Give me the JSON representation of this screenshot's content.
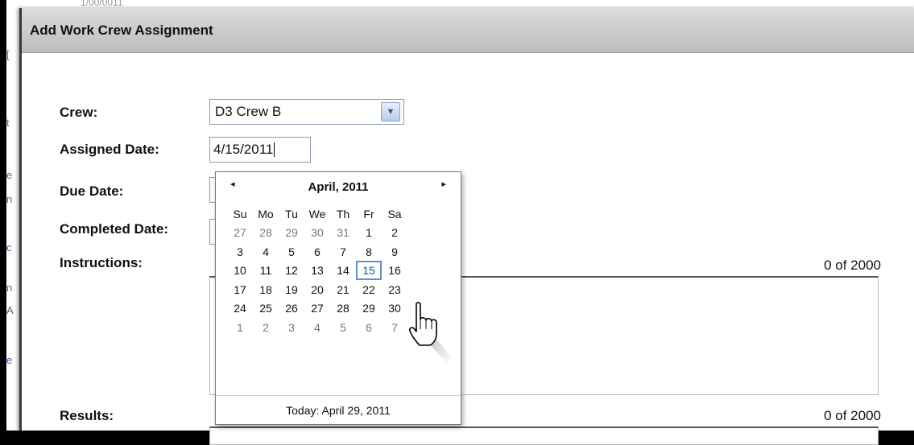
{
  "background": {
    "top_text": "1/00/0011",
    "sliver_chars": [
      "[",
      "t",
      "e",
      "n",
      "c",
      "n",
      "A",
      "e"
    ]
  },
  "dialog": {
    "title": "Add Work Crew Assignment",
    "fields": {
      "crew_label": "Crew:",
      "crew_value": "D3 Crew B",
      "assigned_date_label": "Assigned Date:",
      "assigned_date_value": "4/15/2011",
      "due_date_label": "Due Date:",
      "completed_date_label": "Completed Date:",
      "instructions_label": "Instructions:",
      "instructions_counter": "0 of 2000",
      "results_label": "Results:",
      "results_counter": "0 of 2000"
    }
  },
  "calendar": {
    "month_title": "April, 2011",
    "prev_icon": "◂",
    "next_icon": "▸",
    "weekdays": [
      "Su",
      "Mo",
      "Tu",
      "We",
      "Th",
      "Fr",
      "Sa"
    ],
    "weeks": [
      [
        "27",
        "28",
        "29",
        "30",
        "31",
        "1",
        "2"
      ],
      [
        "3",
        "4",
        "5",
        "6",
        "7",
        "8",
        "9"
      ],
      [
        "10",
        "11",
        "12",
        "13",
        "14",
        "15",
        "16"
      ],
      [
        "17",
        "18",
        "19",
        "20",
        "21",
        "22",
        "23"
      ],
      [
        "24",
        "25",
        "26",
        "27",
        "28",
        "29",
        "30"
      ],
      [
        "1",
        "2",
        "3",
        "4",
        "5",
        "6",
        "7"
      ]
    ],
    "selected_day": "15",
    "today_text": "Today: April 29, 2011"
  },
  "colors": {
    "selection_border": "#5b8fd6",
    "titlebar": "#c8c8c8"
  }
}
